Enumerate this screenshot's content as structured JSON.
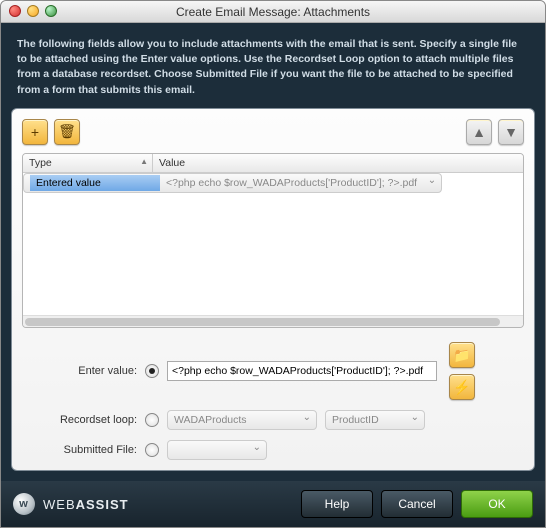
{
  "window": {
    "title": "Create Email Message: Attachments"
  },
  "intro": "The following fields allow you to include attachments with the email that is sent. Specify a single file to be attached using the Enter value options. Use the Recordset Loop option to attach multiple files from a database recordset. Choose Submitted File if you want the file to be attached to be specified from a form that submits this email.",
  "toolbar": {
    "add": "+",
    "trash": "🗑",
    "up": "▲",
    "down": "▼"
  },
  "list": {
    "headers": {
      "type": "Type",
      "value": "Value"
    },
    "rows": [
      {
        "type": "Entered value",
        "value": "<?php echo $row_WADAProducts['ProductID']; ?>.pdf"
      }
    ]
  },
  "form": {
    "enterValue": {
      "label": "Enter value:",
      "value": "<?php echo $row_WADAProducts['ProductID']; ?>.pdf"
    },
    "recordsetLoop": {
      "label": "Recordset loop:",
      "recordset": "WADAProducts",
      "column": "ProductID"
    },
    "submittedFile": {
      "label": "Submitted File:",
      "select": ""
    },
    "browseIcon": "📁",
    "boltIcon": "⚡"
  },
  "footer": {
    "brandThin": "WEB",
    "brandBold": "ASSIST",
    "help": "Help",
    "cancel": "Cancel",
    "ok": "OK"
  }
}
